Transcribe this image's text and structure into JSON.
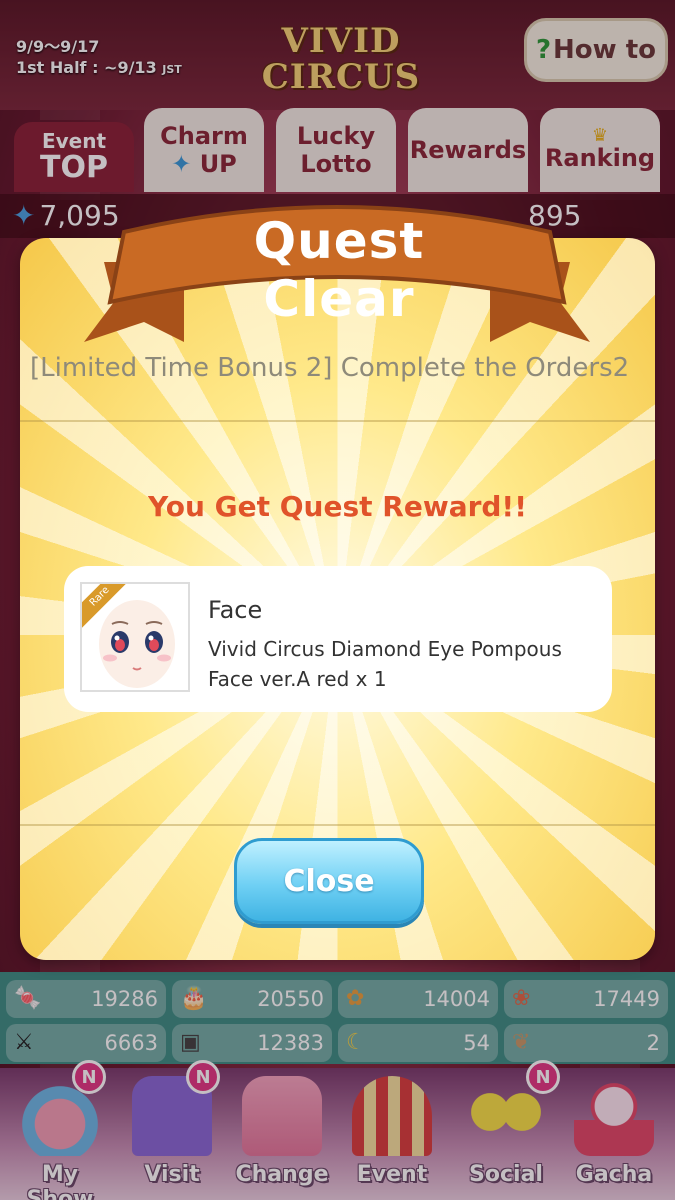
{
  "event": {
    "dates": "9/9～9/17",
    "first_half": "1st Half : ~9/13",
    "tz": "JST",
    "logo_line1": "VIVID",
    "logo_line2": "CIRCUS",
    "how_to_label": "How to"
  },
  "tabs": [
    {
      "line1": "Event",
      "line2": "TOP",
      "active": true
    },
    {
      "line1": "Charm",
      "line2": "UP",
      "active": false
    },
    {
      "line1": "Lucky",
      "line2": "Lotto",
      "active": false
    },
    {
      "line1": "Rewards",
      "active": false
    },
    {
      "line1": "Ranking",
      "active": false
    }
  ],
  "points": {
    "left": "7,095",
    "right": "895"
  },
  "modal": {
    "title": "Quest Clear",
    "quest_name": "[Limited Time Bonus 2] Complete the Orders2",
    "reward_heading": "You Get Quest Reward!!",
    "reward": {
      "rarity": "Rare",
      "category": "Face",
      "name": "Vivid Circus Diamond Eye Pompous Face ver.A red x 1"
    },
    "close_label": "Close"
  },
  "stats": [
    {
      "icon": "candy-icon",
      "value": "19286"
    },
    {
      "icon": "cake-icon",
      "value": "20550"
    },
    {
      "icon": "pinwheel-icon",
      "value": "14004"
    },
    {
      "icon": "bouquet-icon",
      "value": "17449"
    },
    {
      "icon": "sword-icon",
      "value": "6663"
    },
    {
      "icon": "book-icon",
      "value": "12383"
    },
    {
      "icon": "banana-icon",
      "value": "54"
    },
    {
      "icon": "rabbit-icon",
      "value": "2"
    }
  ],
  "nav": [
    {
      "label": "My Show",
      "badge": "N"
    },
    {
      "label": "Visit",
      "badge": "N"
    },
    {
      "label": "Change"
    },
    {
      "label": "Event"
    },
    {
      "label": "Social",
      "badge": "N"
    },
    {
      "label": "Gacha"
    }
  ],
  "colors": {
    "accent_red": "#8a2338",
    "reward_heading": "#e0532a",
    "close_button": "#3fb3e3",
    "ribbon": "#c96a24",
    "badge": "#e23a86"
  }
}
